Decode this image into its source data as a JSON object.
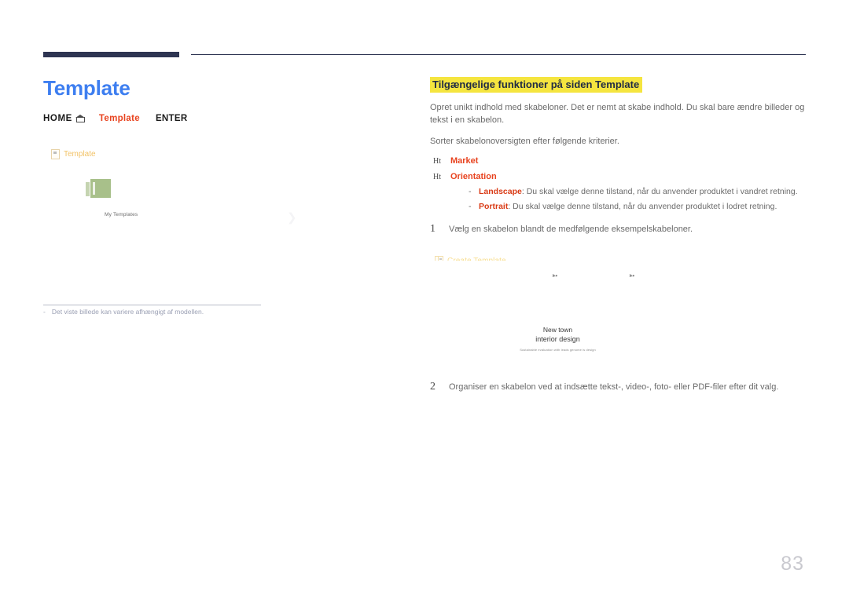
{
  "page": {
    "number": "83"
  },
  "left": {
    "title": "Template",
    "nav": {
      "home_label": "HOME",
      "home_icon": "home-icon",
      "current_label": "Template",
      "enter_label": "ENTER"
    },
    "ui_mock": {
      "header_label": "Template",
      "header_icon": "document-icon",
      "thumbnail_icon": "template-thumbnail-icon",
      "thumbnail_label": "My Templates",
      "arrow_icon": "chevron-right-icon"
    },
    "footnote": {
      "dash": "-",
      "text": "Det viste billede kan variere afhængigt af modellen."
    }
  },
  "right": {
    "heading": "Tilgængelige funktioner på siden Template",
    "paragraphs": [
      "Opret unikt indhold med skabeloner. Det er nemt at skabe indhold. Du skal bare ændre billeder og tekst i en skabelon.",
      "Sorter skabelonoversigten efter følgende kriterier."
    ],
    "criteria": [
      {
        "icon": "Ht",
        "label": "Market"
      },
      {
        "icon": "Ht",
        "label": "Orientation"
      }
    ],
    "sub_items": [
      {
        "dash": "-",
        "term": "Landscape",
        "text": ": Du skal vælge denne tilstand, når du anvender produktet i vandret retning."
      },
      {
        "dash": "-",
        "term": "Portrait",
        "text": ": Du skal vælge denne tilstand, når du anvender produktet i lodret retning."
      }
    ],
    "steps": [
      {
        "number": "1",
        "text": "Vælg en skabelon blandt de medfølgende eksempelskabeloner."
      },
      {
        "number": "2",
        "text": "Organiser en skabelon ved at indsætte tekst-, video-, foto- eller PDF-filer efter dit valg."
      }
    ],
    "create": {
      "icon": "create-template-icon",
      "label": "Create Template"
    },
    "screenshot": {
      "cursor_icon": "cursor-pointer-icon",
      "line1": "New town",
      "line2": "interior design",
      "line3": "Sustainable evaluation with leads genome is design"
    }
  },
  "colors": {
    "title_blue": "#3d7ef0",
    "accent_red": "#e8431f",
    "highlight_yellow": "#f5e53f",
    "navy": "#2e3552",
    "body_gray": "#6a6a6a",
    "gold": "#f7dd8e"
  }
}
